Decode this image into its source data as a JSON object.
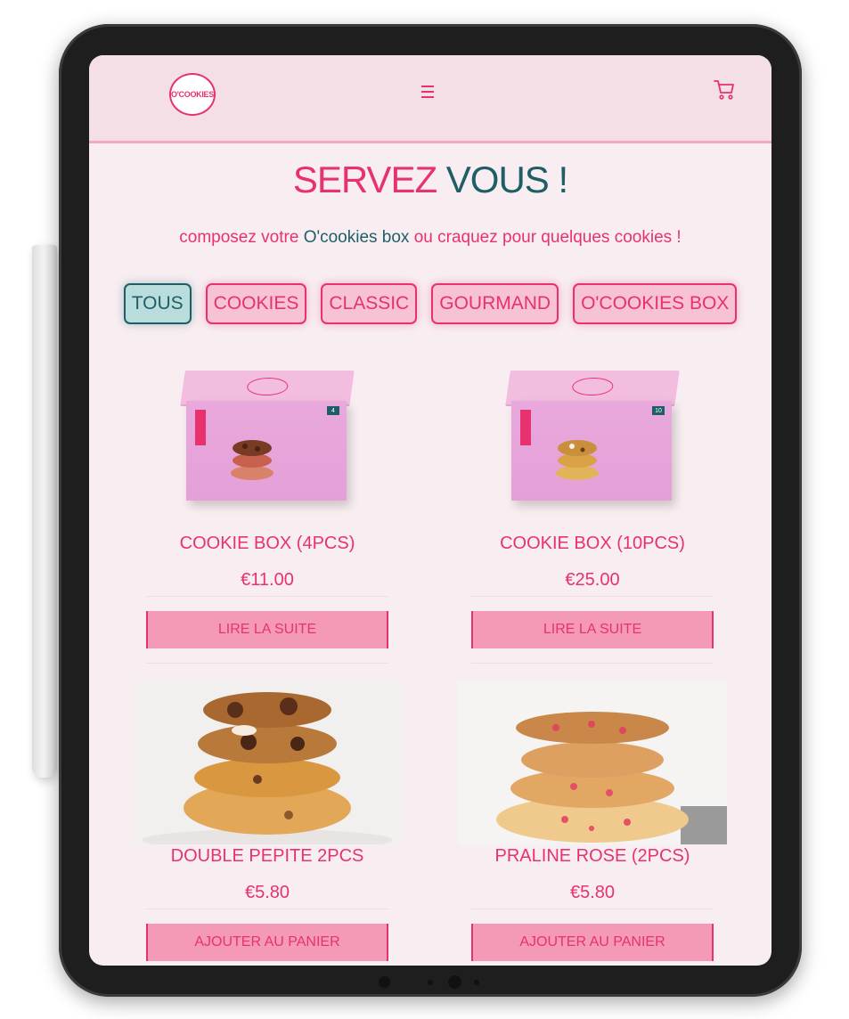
{
  "colors": {
    "accent": "#e8316f",
    "teal": "#1f5e66",
    "background": "#f8eef2",
    "header_bg": "#f4dfe6",
    "button_bg": "#f49ab7"
  },
  "header": {
    "logo_text": "O'COOKIES",
    "menu_icon": "hamburger-menu-icon",
    "cart_icon": "shopping-cart-icon"
  },
  "page": {
    "title_part1": "SERVEZ",
    "title_part2": "VOUS !",
    "subtitle_part1": "composez votre",
    "subtitle_part2": "O'cookies box",
    "subtitle_part3": "ou craquez pour quelques cookies !"
  },
  "filters": [
    {
      "label": "TOUS",
      "active": true
    },
    {
      "label": "COOKIES",
      "active": false
    },
    {
      "label": "CLASSIC",
      "active": false
    },
    {
      "label": "GOURMAND",
      "active": false
    },
    {
      "label": "O'COOKIES BOX",
      "active": false
    }
  ],
  "products": [
    {
      "name": "COOKIE BOX (4PCS)",
      "price": "€11.00",
      "button": "LIRE LA SUITE",
      "box_count": "4"
    },
    {
      "name": "COOKIE BOX (10PCS)",
      "price": "€25.00",
      "button": "LIRE LA SUITE",
      "box_count": "10"
    },
    {
      "name": "DOUBLE PEPITE 2PCS",
      "price": "€5.80",
      "button": "AJOUTER AU PANIER"
    },
    {
      "name": "PRALINE ROSE (2PCS)",
      "price": "€5.80",
      "button": "AJOUTER AU PANIER"
    }
  ]
}
